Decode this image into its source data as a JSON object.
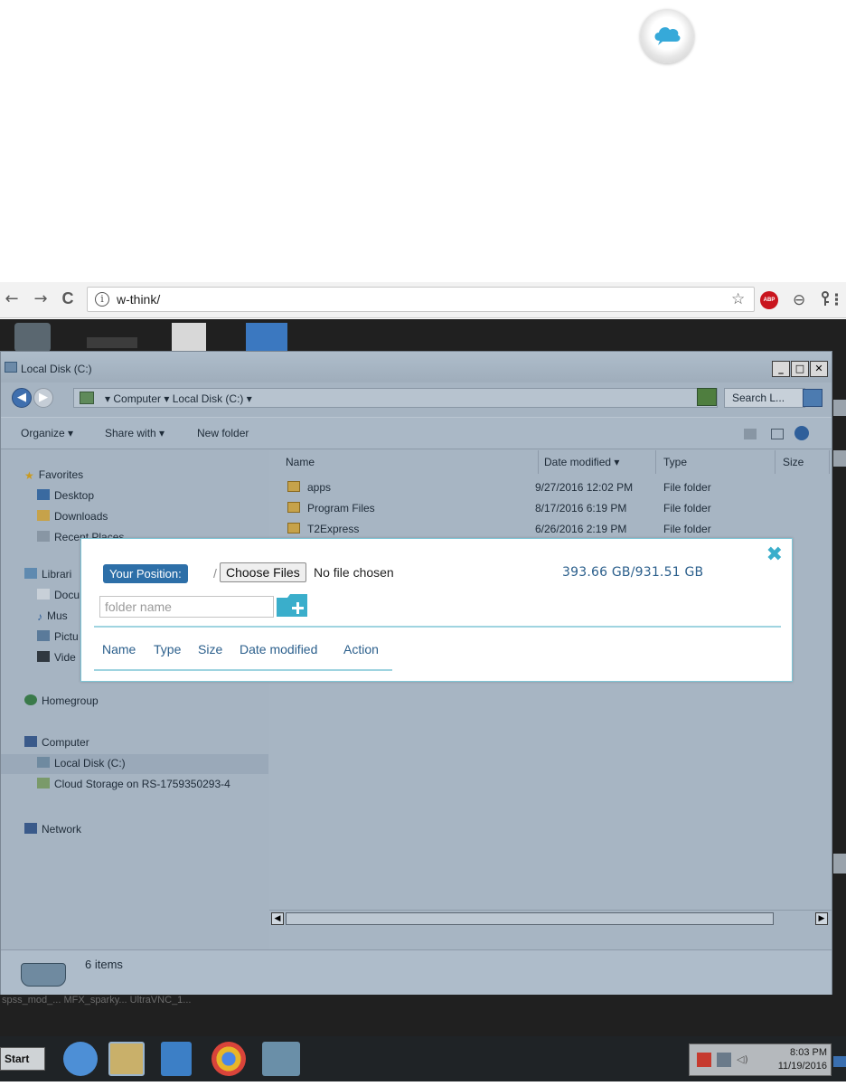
{
  "browser": {
    "url": "w-think/",
    "back_icon": "←",
    "forward_icon": "→",
    "reload_icon": "C",
    "info_icon": "i",
    "key_icon": "key-icon",
    "star_icon": "☆",
    "abp_label": "ABP",
    "ext_icon": "⊖",
    "menu_icon": "⋮"
  },
  "explorer": {
    "title": "Local Disk (C:)",
    "address": "▾ Computer ▾ Local Disk (C:) ▾",
    "search_placeholder": "Search L...",
    "commands": [
      "Organize ▾",
      "Share with ▾",
      "New folder"
    ],
    "nav": {
      "favorites": "Favorites",
      "desktop": "Desktop",
      "downloads": "Downloads",
      "recent": "Recent Places",
      "libraries": "Librari",
      "documents": "Docu",
      "music": "Mus",
      "pictures": "Pictu",
      "videos": "Vide",
      "homegroup": "Homegroup",
      "computer": "Computer",
      "local_disk": "Local Disk (C:)",
      "cloud_storage": "Cloud Storage on RS-1759350293-4",
      "network": "Network"
    },
    "columns": {
      "name": "Name",
      "date": "Date modified ▾",
      "type": "Type",
      "size": "Size"
    },
    "files": [
      {
        "name": "apps",
        "date": "9/27/2016 12:02 PM",
        "type": "File folder"
      },
      {
        "name": "Program Files",
        "date": "8/17/2016 6:19 PM",
        "type": "File folder"
      },
      {
        "name": "T2Express",
        "date": "6/26/2016 2:19 PM",
        "type": "File folder"
      }
    ],
    "item_count": "6 items"
  },
  "desktop_labels": "spss_mod_...  MFX_sparky...  UltraVNC_1...",
  "taskbar": {
    "start": "Start",
    "time": "8:03 PM",
    "date": "11/19/2016"
  },
  "modal": {
    "position_label": "Your Position:",
    "path_separator": "/",
    "choose_files": "Choose Files",
    "no_file": "No file chosen",
    "storage": "393.66 GB/931.51 GB",
    "folder_placeholder": "folder name",
    "close_icon": "✖",
    "table_headers": [
      "Name",
      "Type",
      "Size",
      "Date modified",
      "Action"
    ]
  },
  "colors": {
    "accent": "#3aaecb",
    "badge": "#2d6fa8",
    "link_text": "#2b5f8c"
  }
}
